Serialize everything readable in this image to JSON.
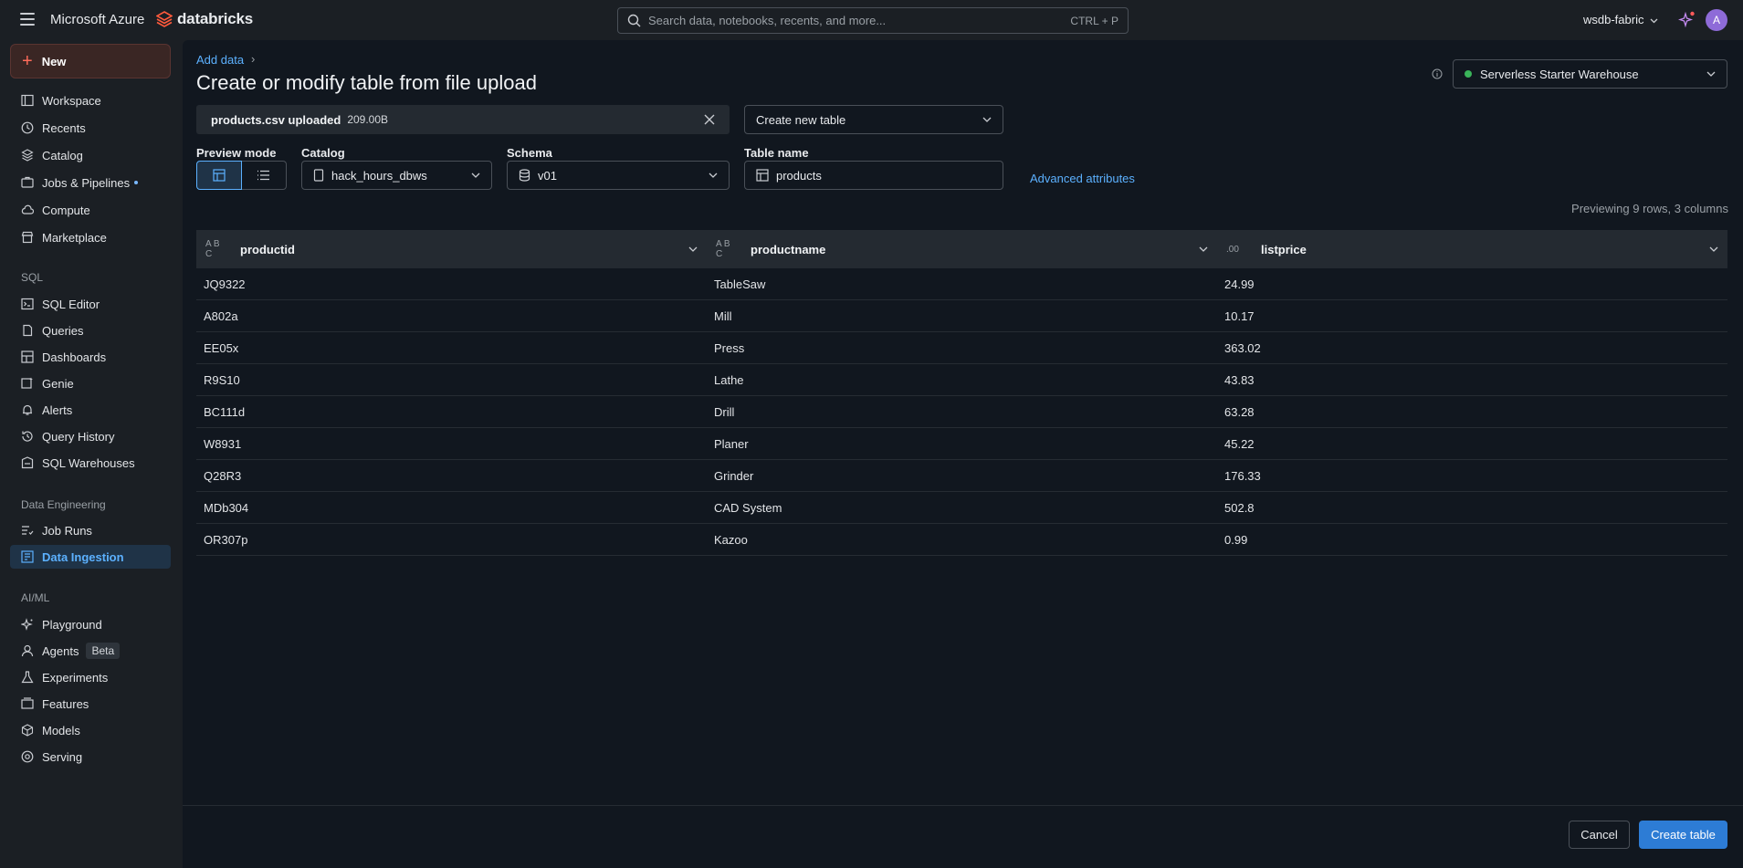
{
  "header": {
    "brand_ms": "Microsoft Azure",
    "brand_db": "databricks",
    "search_placeholder": "Search data, notebooks, recents, and more...",
    "search_shortcut": "CTRL + P",
    "workspace": "wsdb-fabric",
    "avatar_initial": "A"
  },
  "sidebar": {
    "new_label": "New",
    "items": [
      "Workspace",
      "Recents",
      "Catalog",
      "Jobs & Pipelines",
      "Compute",
      "Marketplace"
    ],
    "sql_heading": "SQL",
    "sql_items": [
      "SQL Editor",
      "Queries",
      "Dashboards",
      "Genie",
      "Alerts",
      "Query History",
      "SQL Warehouses"
    ],
    "de_heading": "Data Engineering",
    "de_items": [
      "Job Runs",
      "Data Ingestion"
    ],
    "ai_heading": "AI/ML",
    "ai_items": [
      "Playground",
      "Agents",
      "Experiments",
      "Features",
      "Models",
      "Serving"
    ],
    "beta_badge": "Beta",
    "active": "Data Ingestion"
  },
  "page": {
    "breadcrumb": "Add data",
    "title": "Create or modify table from file upload",
    "warehouse": "Serverless Starter Warehouse",
    "upload_file": "products.csv uploaded",
    "upload_size": "209.00B",
    "create_mode": "Create new table",
    "preview_mode_label": "Preview mode",
    "catalog_label": "Catalog",
    "catalog_value": "hack_hours_dbws",
    "schema_label": "Schema",
    "schema_value": "v01",
    "table_name_label": "Table name",
    "table_name_value": "products",
    "advanced_link": "Advanced attributes",
    "preview_info": "Previewing 9 rows, 3 columns"
  },
  "table": {
    "columns": [
      {
        "type": "string",
        "type_label": "A B C",
        "name": "productid"
      },
      {
        "type": "string",
        "type_label": "A B C",
        "name": "productname"
      },
      {
        "type": "decimal",
        "type_label": ".00",
        "name": "listprice"
      }
    ],
    "rows": [
      [
        "JQ9322",
        "TableSaw",
        "24.99"
      ],
      [
        "A802a",
        "Mill",
        "10.17"
      ],
      [
        "EE05x",
        "Press",
        "363.02"
      ],
      [
        "R9S10",
        "Lathe",
        "43.83"
      ],
      [
        "BC111d",
        "Drill",
        "63.28"
      ],
      [
        "W8931",
        "Planer",
        "45.22"
      ],
      [
        "Q28R3",
        "Grinder",
        "176.33"
      ],
      [
        "MDb304",
        "CAD System",
        "502.8"
      ],
      [
        "OR307p",
        "Kazoo",
        "0.99"
      ]
    ]
  },
  "footer": {
    "cancel": "Cancel",
    "create": "Create table"
  },
  "colors": {
    "accent": "#5cb1ff",
    "primary_button": "#2d7cd5",
    "status_green": "#3ab45a",
    "new_plus": "#ff6b5a"
  }
}
